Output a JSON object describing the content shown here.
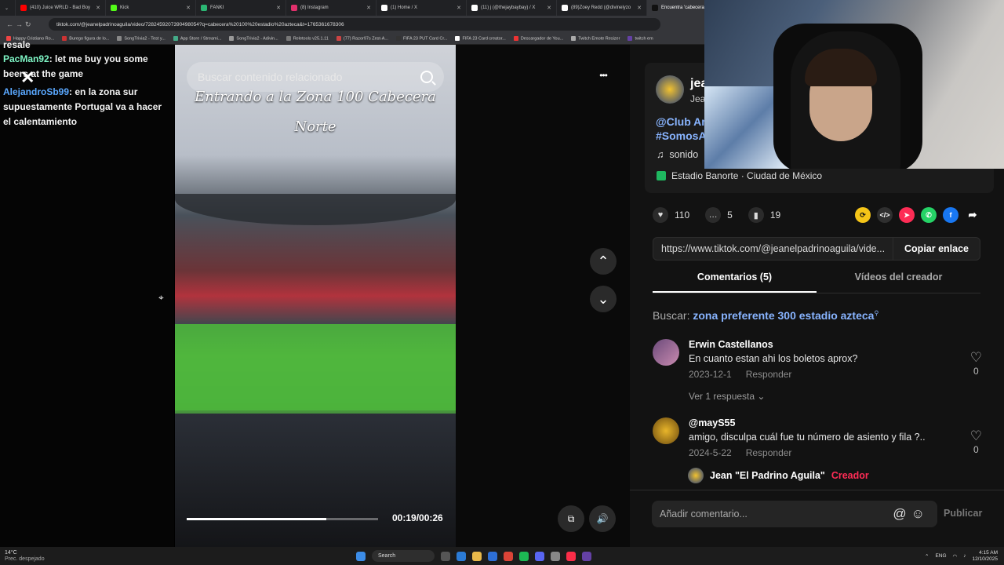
{
  "browser": {
    "tabs": [
      {
        "title": "(410) Juice WRLD - Bad Boy",
        "color": "#ff0000"
      },
      {
        "title": "Kick",
        "color": "#53fc18"
      },
      {
        "title": "FANKI",
        "color": "#2bb673"
      },
      {
        "title": "(8) Instagram",
        "color": "#e1306c"
      },
      {
        "title": "(1) Home / X",
        "color": "#ffffff"
      },
      {
        "title": "(11) j (@thejaybaybay) / X",
        "color": "#ffffff"
      },
      {
        "title": "(89)Zoey Redd (@divinelyzo",
        "color": "#ffffff"
      },
      {
        "title": "Encuentra 'cabecera 1",
        "color": "#111111"
      }
    ],
    "url": "tiktok.com/@jeanelpadrinoaguila/video/7282459207390498054?q=cabecera%20100%20estadio%20azteca&t=1765361678306",
    "bookmarks": [
      "Happy Cristiano Ro...",
      "Burego figura de lo...",
      "SongTrivia2 - Test y...",
      "App Store / Streami...",
      "SongTrivia2 - Adivin...",
      "Reletools v25.1.11",
      "(77) Razor97s Zest-A...",
      "FIFA 23 PUT Card Cr...",
      "FIFA 23 Card creator...",
      "Descargador de You...",
      "Twitch Emote Resizer",
      "twitch em"
    ]
  },
  "chat": {
    "cut_top": "resale",
    "messages": [
      {
        "user": "PacMan92",
        "text": ": let me buy you some beers at the game"
      },
      {
        "user": "AlejandroSb99",
        "text": ": en la zona sur supuestamente Portugal va a hacer el calentamiento"
      }
    ]
  },
  "video": {
    "search_placeholder": "Buscar contenido relacionado",
    "caption_line1": "Entrando a la Zona 100 Cabecera",
    "caption_line2": "Norte",
    "time": "00:19/00:26",
    "progress": 0.73,
    "close_glyph": "✕"
  },
  "controls": {
    "more": "•••",
    "up": "⌃",
    "down": "⌄",
    "volume": "🔊",
    "pip": "⧉"
  },
  "post": {
    "author": "jea",
    "author_sub": "Jea",
    "hashtags_1": "@Club Am",
    "hashtags_2": "#SomosA",
    "sound": "sonido",
    "location": "Estadio Banorte · Ciudad de México",
    "likes": "110",
    "comments": "5",
    "saves": "19",
    "link": "https://www.tiktok.com/@jeanelpadrinoaguila/vide...",
    "copy_label": "Copiar enlace",
    "tab_comments": "Comentarios (5)",
    "tab_videos": "Vídeos del creador",
    "related_label": "Buscar:",
    "related_query": "zona preferente 300 estadio azteca"
  },
  "comments": [
    {
      "name": "Erwin Castellanos",
      "text": "En cuanto estan ahi los boletos aprox?",
      "date": "2023-12-1",
      "reply": "Responder",
      "likes": "0"
    },
    {
      "name": "@mayS55",
      "text": "amigo, disculpa cuál fue tu número de asiento y fila ?..",
      "date": "2024-5-22",
      "reply": "Responder",
      "likes": "0"
    }
  ],
  "more_replies": "Ver 1 respuesta",
  "creator_reply": {
    "name": "Jean \"El Padrino Aguila\"",
    "badge": "Creador"
  },
  "compose": {
    "placeholder": "Añadir comentario...",
    "publish": "Publicar"
  },
  "taskbar": {
    "temp": "14°C",
    "weather": "Prec. despejado",
    "search": "Search",
    "lang": "ENG",
    "time": "4:15 AM",
    "date": "12/10/2025"
  },
  "colors": {
    "accent": "#88b4ff",
    "creator": "#fe2c55",
    "tiktok_bg": "#121212"
  }
}
